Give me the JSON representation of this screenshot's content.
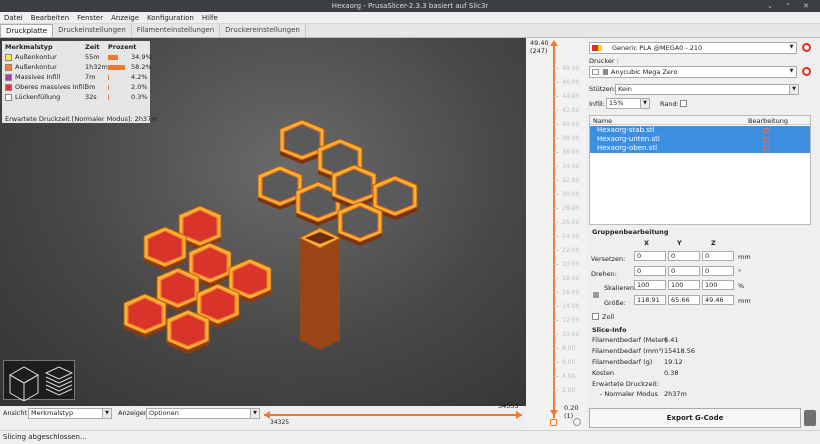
{
  "window": {
    "title": "Hexaorg - PrusaSlicer-2.3.3 basiert auf Slic3r"
  },
  "menu": [
    "Datei",
    "Bearbeiten",
    "Fenster",
    "Anzeige",
    "Konfiguration",
    "Hilfe"
  ],
  "tabs": [
    {
      "label": "Druckplatte",
      "active": true
    },
    {
      "label": "Druckeinstellungen",
      "active": false
    },
    {
      "label": "Filamenteinstellungen",
      "active": false
    },
    {
      "label": "Druckereinstellungen",
      "active": false
    }
  ],
  "legend": {
    "headers": {
      "type": "Merkmalstyp",
      "time": "Zeit",
      "percent": "Prozent"
    },
    "rows": [
      {
        "name": "Außenkontur",
        "time": "55m",
        "percent": "34.9%",
        "value": 34.9,
        "color": "#ffe64d"
      },
      {
        "name": "Außenkontur",
        "time": "1h32m",
        "percent": "58.2%",
        "value": 58.2,
        "color": "#ff7d38"
      },
      {
        "name": "Massives Infill",
        "time": "7m",
        "percent": "4.2%",
        "value": 4.2,
        "color": "#b03aa8"
      },
      {
        "name": "Oberes massives Infill",
        "time": "3m",
        "percent": "2.0%",
        "value": 2.0,
        "color": "#f0302f"
      },
      {
        "name": "Lückenfüllung",
        "time": "32s",
        "percent": "0.3%",
        "value": 0.3,
        "color": "#ffffff"
      }
    ],
    "footer": "Erwartete Druckzeit [Normaler Modus]:  2h37m"
  },
  "bottom": {
    "view_label": "Ansicht",
    "view_value": "Merkmalstyp",
    "show_label": "Anzeigen",
    "show_value": "Optionen",
    "slider_right": "34353",
    "slider_left": "34325"
  },
  "layer_slider": {
    "top_height": "49.40",
    "top_layer": "(247)",
    "bottom_height": "0.20",
    "bottom_layer": "(1)",
    "ticks": [
      "48.00",
      "46.00",
      "44.00",
      "42.00",
      "40.00",
      "38.00",
      "36.00",
      "34.00",
      "32.00",
      "30.00",
      "28.00",
      "26.00",
      "24.00",
      "22.00",
      "20.00",
      "18.00",
      "16.00",
      "14.00",
      "12.00",
      "10.00",
      "8.00",
      "6.00",
      "4.00",
      "2.00"
    ]
  },
  "panel": {
    "filament": "Generic PLA @MEGA0 - 210",
    "printer_label": "Drucker :",
    "printer": "Anycubic Mega Zero",
    "supports_label": "Stützen:",
    "supports": "Kein",
    "infill_label": "Infill:",
    "infill": "15%",
    "brim_label": "Rand:",
    "list_headers": {
      "name": "Name",
      "edit": "Bearbeitung"
    },
    "objects": [
      "Hexaorg-stab.stl",
      "Hexaorg-unten.stl",
      "Hexaorg-oben.stl"
    ],
    "group_title": "Gruppenbearbeitung",
    "axes": [
      "X",
      "Y",
      "Z"
    ],
    "transform": [
      {
        "label": "Versetzen:",
        "x": "0",
        "y": "0",
        "z": "0",
        "unit": "mm"
      },
      {
        "label": "Drehen:",
        "x": "0",
        "y": "0",
        "z": "0",
        "unit": "°"
      },
      {
        "label": "Skalieren:",
        "x": "100",
        "y": "100",
        "z": "100",
        "unit": "%"
      },
      {
        "label": "Größe:",
        "x": "118.91",
        "y": "65.66",
        "z": "49.46",
        "unit": "mm"
      }
    ],
    "inch_label": "Zoll",
    "slice_title": "Slice-Info",
    "slice_info": [
      {
        "label": "Filamentbedarf (Meter)",
        "value": "6.41"
      },
      {
        "label": "Filamentbedarf (mm³)",
        "value": "15418.56"
      },
      {
        "label": "Filamentbedarf (g)",
        "value": "19.12"
      },
      {
        "label": "Kosten",
        "value": "0.38"
      }
    ],
    "print_time_label": "Erwartete Druckzeit:",
    "print_mode_label": "- Normaler Modus",
    "print_mode_value": "2h37m",
    "export_label": "Export G-Code"
  },
  "status": "Slicing abgeschlossen..."
}
